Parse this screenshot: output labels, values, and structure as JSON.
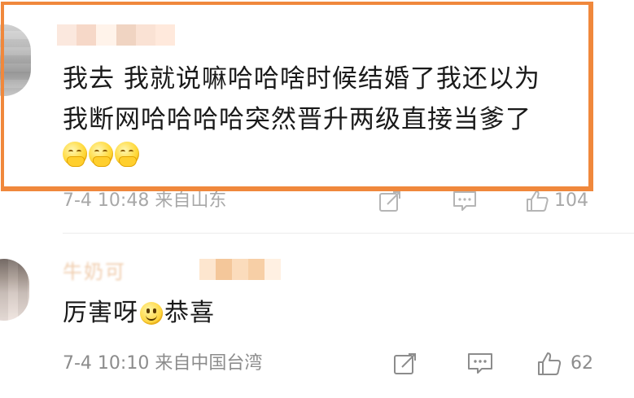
{
  "comments": [
    {
      "lines": [
        "我去 我就说嘛哈哈啥时候结婚了我还以为",
        "我断网哈哈哈哈突然晋升两级直接当爹了"
      ],
      "emoji_icons": [
        "shy-face-icon",
        "shy-face-icon",
        "shy-face-icon"
      ],
      "meta": "7-4 10:48 来自山东",
      "like_count": "104",
      "highlight_color": "#f0883c"
    },
    {
      "name_visible": "牛奶可",
      "text_before_emoji": "厉害呀",
      "emoji_icon": "smile-face-icon",
      "text_after_emoji": "恭喜",
      "meta": "7-4 10:10 来自中国台湾",
      "like_count": "62"
    }
  ],
  "colors": {
    "text_primary": "#1a1a1a",
    "text_meta": "#8c8c8c",
    "divider": "#ececec",
    "highlight": "#f0883c"
  }
}
